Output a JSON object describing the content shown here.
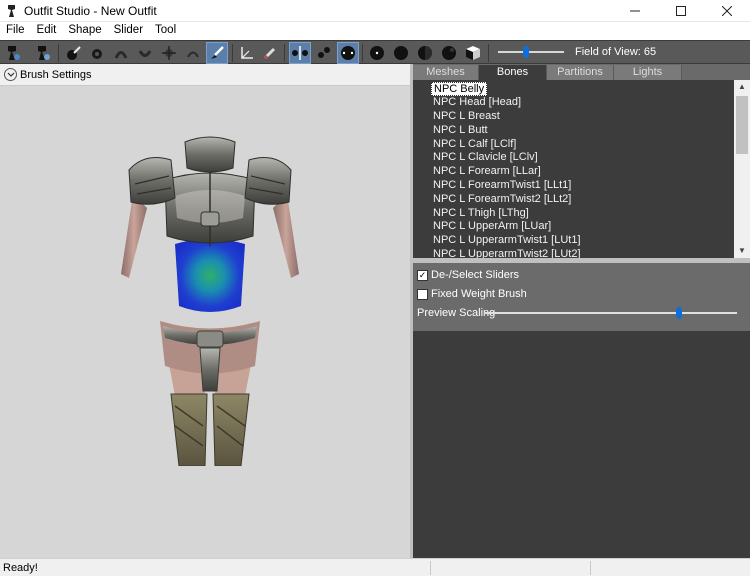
{
  "window": {
    "title": "Outfit Studio - New Outfit"
  },
  "menu": [
    "File",
    "Edit",
    "Shape",
    "Slider",
    "Tool"
  ],
  "toolbar": {
    "fov_label": "Field of View: 65",
    "fov_level": 0.42,
    "icons": [
      "app-tool-icon",
      "app-tool-icon-2",
      "select-brush-icon",
      "mask-brush-icon",
      "inflate-brush-icon",
      "deflate-brush-icon",
      "move-brush-icon",
      "smooth-brush-icon",
      "weight-brush-icon",
      "transform-icon",
      "pivot-icon",
      "mirror-x-icon",
      "mirror-y-icon",
      "mirror-z-icon",
      "vertex-view-icon",
      "shade-view-icon",
      "wire-view-icon",
      "texture-view-icon",
      "cube-view-icon"
    ]
  },
  "left": {
    "brush_settings": "Brush Settings"
  },
  "right": {
    "tabs": [
      "Meshes",
      "Bones",
      "Partitions",
      "Lights"
    ],
    "active_tab": "Bones",
    "bones": [
      "NPC Belly",
      "NPC Head [Head]",
      "NPC L Breast",
      "NPC L Butt",
      "NPC L Calf [LClf]",
      "NPC L Clavicle [LClv]",
      "NPC L Forearm [LLar]",
      "NPC L ForearmTwist1 [LLt1]",
      "NPC L ForearmTwist2 [LLt2]",
      "NPC L Thigh [LThg]",
      "NPC L UpperArm [LUar]",
      "NPC L UpperarmTwist1 [LUt1]",
      "NPC L UpperarmTwist2 [LUt2]"
    ],
    "options": {
      "deselect_sliders": {
        "label": "De-/Select Sliders",
        "checked": true
      },
      "fixed_weight": {
        "label": "Fixed Weight Brush",
        "checked": false
      },
      "preview_scaling": {
        "label": "Preview Scaling",
        "level": 0.77
      }
    }
  },
  "status": {
    "text": "Ready!"
  },
  "colors": {
    "toolbar": "#595959",
    "panel_dark": "#3c3c3c",
    "accent": "#0d6fd8",
    "weight_paint": "#1f3fd0"
  }
}
